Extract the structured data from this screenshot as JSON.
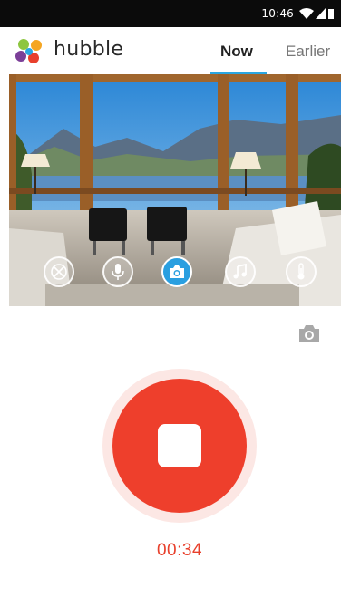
{
  "status_bar": {
    "time": "10:46",
    "icons": [
      "wifi-icon",
      "signal-icon",
      "battery-icon"
    ]
  },
  "app": {
    "name": "hubble",
    "logo_colors": [
      "#8dc63f",
      "#f5a623",
      "#e8402c",
      "#7b3f98",
      "#2aa6e0"
    ]
  },
  "tabs": [
    {
      "label": "Now",
      "active": true
    },
    {
      "label": "Earlier",
      "active": false
    }
  ],
  "camera_controls": [
    {
      "name": "pan-tilt",
      "icon": "joystick-icon",
      "active": false
    },
    {
      "name": "talk",
      "icon": "microphone-icon",
      "active": false
    },
    {
      "name": "snapshot",
      "icon": "camera-icon",
      "active": true
    },
    {
      "name": "lullaby",
      "icon": "music-note-icon",
      "active": false
    },
    {
      "name": "temperature",
      "icon": "thermometer-icon",
      "active": false
    }
  ],
  "recording": {
    "timer": "00:34",
    "state": "recording"
  },
  "colors": {
    "accent": "#2aa6e0",
    "record": "#ee3f2c",
    "record_halo": "#fce7e4"
  }
}
